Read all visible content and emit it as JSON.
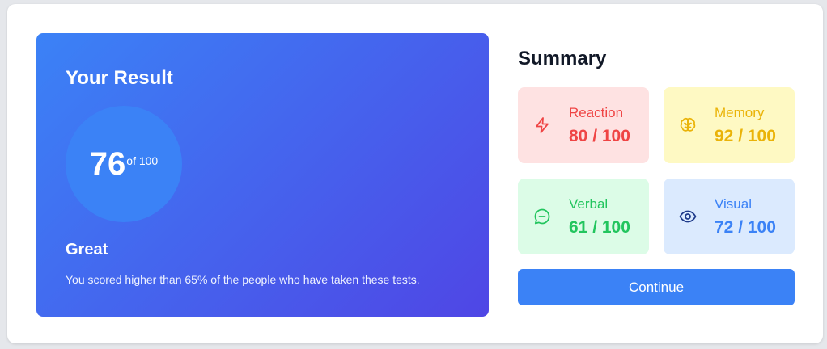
{
  "result": {
    "title": "Your Result",
    "score": "76",
    "score_suffix": "of 100",
    "rating": "Great",
    "description": "You scored higher than 65% of the people who have taken these tests."
  },
  "summary": {
    "title": "Summary",
    "tiles": [
      {
        "label": "Reaction",
        "value": "80 / 100",
        "icon": "lightning-icon",
        "color": "#ef4444",
        "background": "#fee2e2"
      },
      {
        "label": "Memory",
        "value": "92 / 100",
        "icon": "brain-icon",
        "color": "#eab308",
        "background": "#fef9c3"
      },
      {
        "label": "Verbal",
        "value": "61 / 100",
        "icon": "chat-bubble-icon",
        "color": "#22c55e",
        "background": "#dcfce7"
      },
      {
        "label": "Visual",
        "value": "72 / 100",
        "icon": "eye-icon",
        "color": "#3b82f6",
        "background": "#dbeafe"
      }
    ]
  },
  "continue_label": "Continue",
  "colors": {
    "gradient_start": "#3b82f6",
    "gradient_end": "#4f46e5",
    "accent": "#3b82f6"
  }
}
